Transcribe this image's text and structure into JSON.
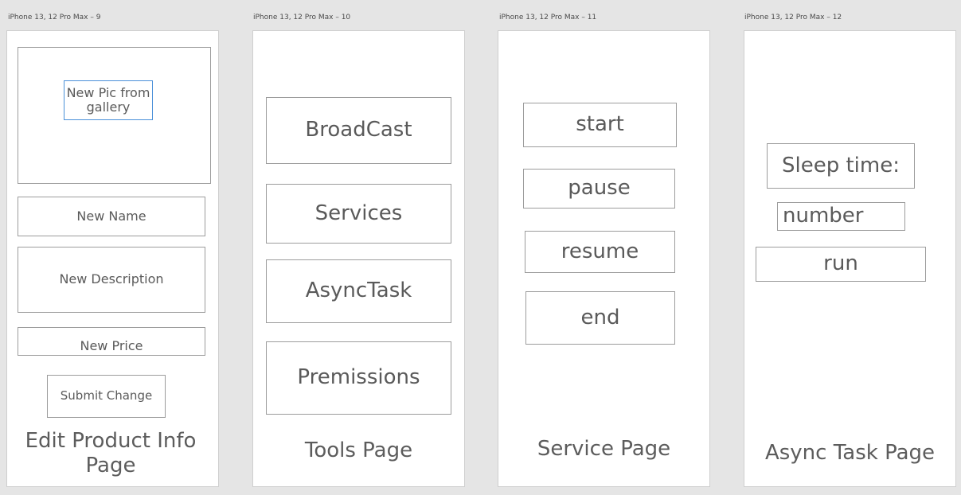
{
  "artboards": [
    {
      "label": "iPhone 13, 12 Pro Max – 9",
      "image_button": "New Pic from gallery",
      "name_field": "New Name",
      "description_field": "New Description",
      "price_field": "New Price",
      "submit_button": "Submit Change",
      "page_title": "Edit Product Info Page"
    },
    {
      "label": "iPhone 13, 12 Pro Max – 10",
      "buttons": [
        "BroadCast",
        "Services",
        "AsyncTask",
        "Premissions"
      ],
      "page_title": "Tools Page"
    },
    {
      "label": "iPhone 13, 12 Pro Max – 11",
      "buttons": [
        "start",
        "pause",
        "resume",
        "end"
      ],
      "page_title": "Service Page"
    },
    {
      "label": "iPhone 13, 12 Pro Max – 12",
      "sleep_label": "Sleep time:",
      "number_field": "number",
      "run_button": "run",
      "page_title": "Async Task Page"
    }
  ]
}
